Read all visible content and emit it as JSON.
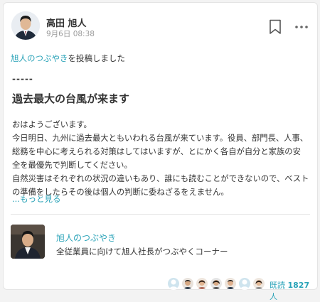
{
  "post": {
    "author_name": "高田 旭人",
    "timestamp": "9月6日 08:38",
    "channel_link": "旭人のつぶやき",
    "posted_suffix": "を投稿しました",
    "dashes": "-----",
    "title": "過去最大の台風が来ます",
    "body_lines": [
      "おはようございます。",
      "今日明日、九州に過去最大ともいわれる台風が来ています。役員、部門長、人事、",
      "総務を中心に考えられる対策はしてはいますが、とにかく各自が自分と家族の安",
      "全を最優先で判断してください。",
      "自然災害はそれぞれの状況の違いもあり、誰にも読むことができないので、ベスト",
      "の準備をしたらその後は個人の判断に委ねざるをえません。"
    ],
    "more_label": "...もっと見る"
  },
  "channel": {
    "name": "旭人のつぶやき",
    "description": "全従業員に向けて旭人社長がつぶやくコーナー"
  },
  "footer": {
    "read_label": "既読",
    "read_count": "1827",
    "read_unit": "人"
  },
  "colors": {
    "accent": "#2aa3b8",
    "text": "#333333",
    "muted": "#9a9a9a"
  },
  "icons": [
    "bookmark-icon",
    "more-options-icon"
  ]
}
